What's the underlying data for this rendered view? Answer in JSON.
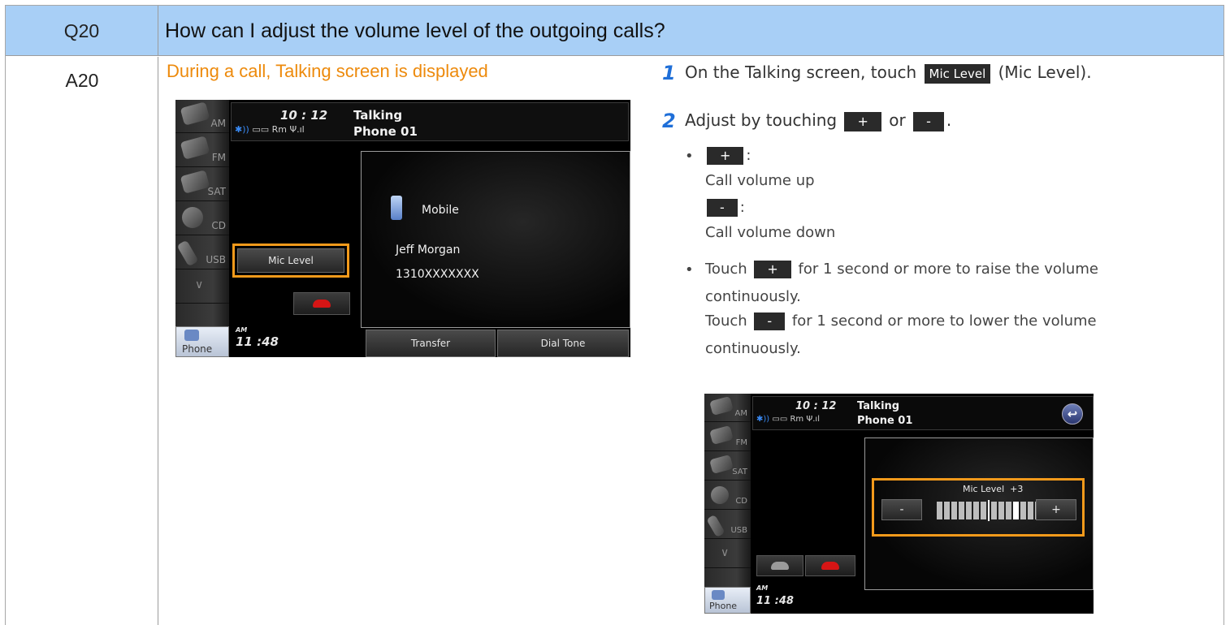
{
  "header": {
    "question_id": "Q20",
    "question": "How can I adjust the volume level of the outgoing calls?"
  },
  "answer": {
    "answer_id": "A20",
    "caption": "During a call, Talking screen is displayed"
  },
  "screen1": {
    "clock": "10 : 12",
    "status": "Rm",
    "title": "Talking",
    "subtitle": "Phone 01",
    "sources": [
      "AM",
      "FM",
      "SAT",
      "CD",
      "USB"
    ],
    "chevron": "∨",
    "phone_tab": "Phone",
    "caller_type": "Mobile",
    "caller_name": "Jeff Morgan",
    "caller_number": "1310XXXXXXX",
    "mic_level_button": "Mic Level",
    "transfer_button": "Transfer",
    "dial_tone_button": "Dial Tone",
    "ampm": "AM",
    "time": "11 :48"
  },
  "steps": {
    "step1": {
      "number": "1",
      "before": "On the Talking screen, touch",
      "button": "Mic Level",
      "after": "(Mic Level)."
    },
    "step2": {
      "number": "2",
      "before": "Adjust by touching",
      "plus": "+",
      "or": "or",
      "minus": "-",
      "period": "."
    },
    "bullet_plus_label": "+",
    "bullet_plus_desc": "Call volume up",
    "bullet_minus_label": "-",
    "bullet_minus_desc": "Call volume down",
    "hold_plus_before": "Touch",
    "hold_plus_after": "for 1 second or more to raise the volume",
    "hold_plus_cont": "continuously.",
    "hold_minus_before": "Touch",
    "hold_minus_after": "for 1 second or more to lower the volume",
    "hold_minus_cont": "continuously.",
    "bullet_dot": "•",
    "colon": ":"
  },
  "screen2": {
    "clock": "10 : 12",
    "status": "Rm",
    "title": "Talking",
    "subtitle": "Phone 01",
    "sources": [
      "AM",
      "FM",
      "SAT",
      "CD",
      "USB"
    ],
    "chevron": "∨",
    "phone_tab": "Phone",
    "back_icon": "↩",
    "mic_level_label": "Mic Level",
    "mic_level_value": "+3",
    "minus_button": "-",
    "plus_button": "+",
    "ampm": "AM",
    "time": "11 :48",
    "meter_total_bars": 14,
    "meter_level_index": 10
  },
  "colors": {
    "header_bg": "#a8cff6",
    "caption_orange": "#ed8a0c",
    "highlight_orange": "#f39a1b",
    "step_blue": "#1f6fd8"
  }
}
